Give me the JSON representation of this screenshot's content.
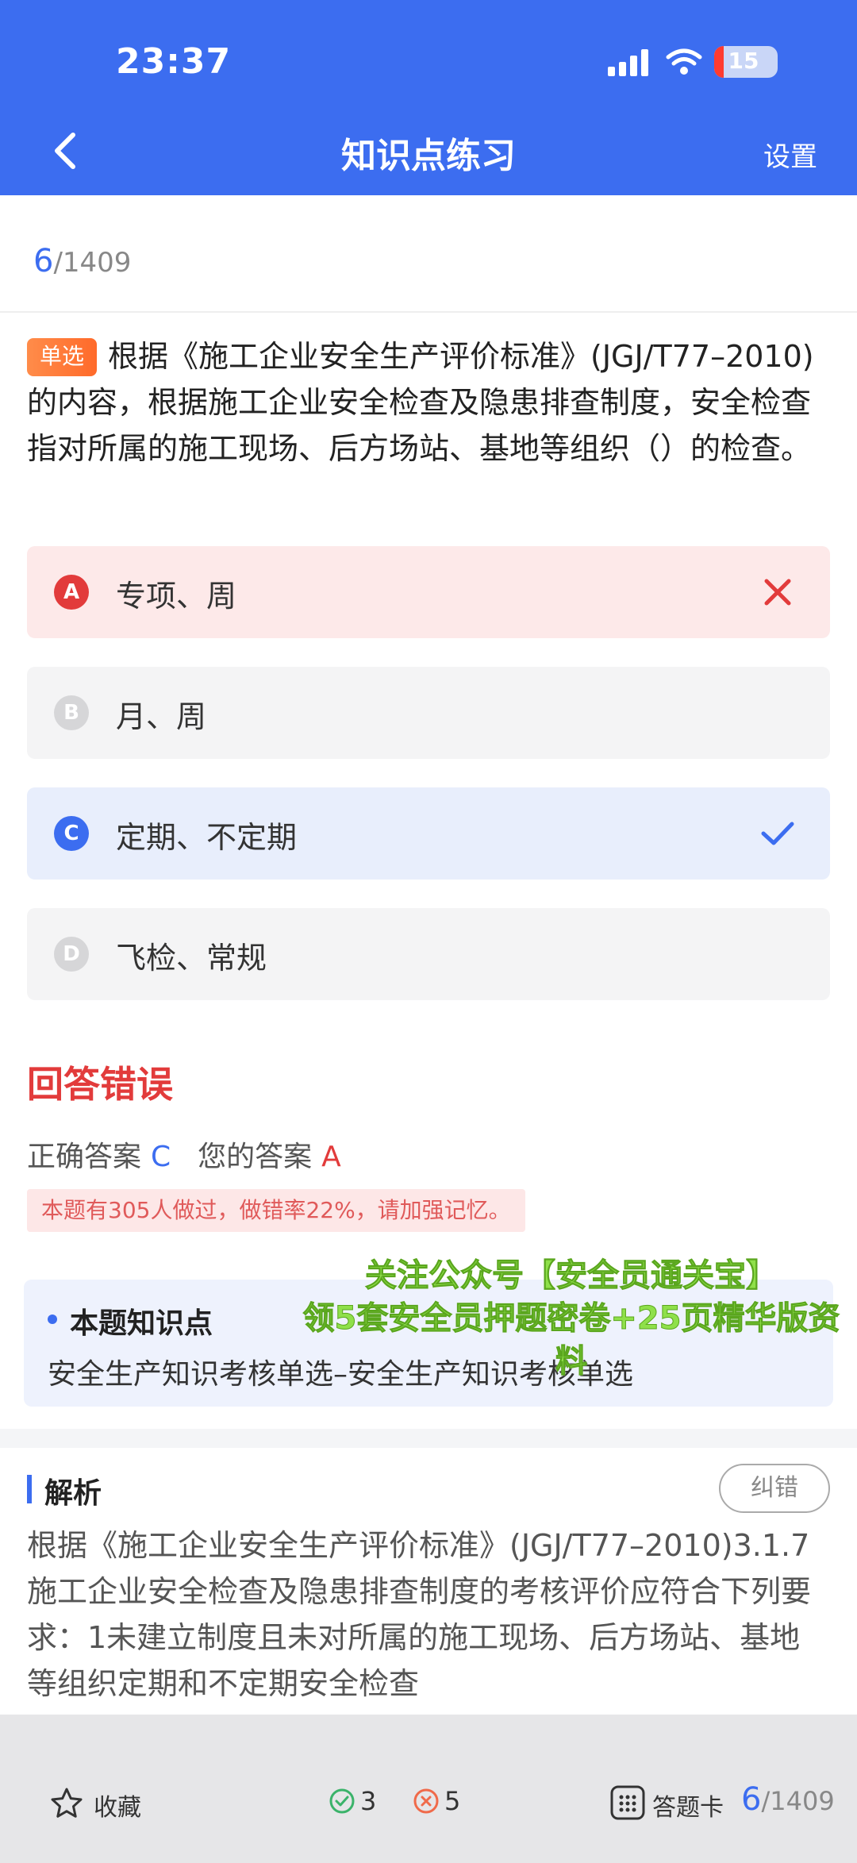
{
  "status_bar": {
    "time": "23:37",
    "battery": "15",
    "battery_fraction": 0.15
  },
  "header": {
    "title": "知识点练习",
    "settings_label": "设置"
  },
  "progress": {
    "current": "6",
    "total": "/1409"
  },
  "question": {
    "type_tag": "单选",
    "text": "根据《施工企业安全生产评价标准》(JGJ/T77–2010)的内容，根据施工企业安全检查及隐患排查制度，安全检查指对所属的施工现场、后方场站、基地等组织（）的检查。"
  },
  "options": [
    {
      "letter": "A",
      "text": "专项、周",
      "state": "wrong"
    },
    {
      "letter": "B",
      "text": "月、周",
      "state": "normal"
    },
    {
      "letter": "C",
      "text": "定期、不定期",
      "state": "correct"
    },
    {
      "letter": "D",
      "text": "飞检、常规",
      "state": "normal"
    }
  ],
  "result": {
    "title": "回答错误",
    "correct_label": "正确答案",
    "correct_value": "C",
    "yours_label": "您的答案",
    "yours_value": "A",
    "hint": "本题有305人做过，做错率22%，请加强记忆。"
  },
  "knowledge": {
    "title": "本题知识点",
    "text": "安全生产知识考核单选–安全生产知识考核单选"
  },
  "promo": {
    "line1": "关注公众号【安全员通关宝】",
    "line2": "领5套安全员押题密卷+25页精华版资料"
  },
  "analysis": {
    "title": "解析",
    "correction_button": "纠错",
    "text": "根据《施工企业安全生产评价标准》(JGJ/T77–2010)3.1.7施工企业安全检查及隐患排查制度的考核评价应符合下列要求：1未建立制度且未对所属的施工现场、后方场站、基地等组织定期和不定期安全检查"
  },
  "bottom_bar": {
    "favorite_label": "收藏",
    "correct_count": "3",
    "wrong_count": "5",
    "answer_card_label": "答题卡",
    "current": "6",
    "total": "/1409"
  },
  "colors": {
    "primary": "#3c6df0",
    "error": "#e23b3b",
    "wrong_bg": "#fde9e9",
    "correct_bg": "#e8eefc",
    "normal_bg": "#f4f4f5",
    "promo_green": "#8fe04a"
  }
}
